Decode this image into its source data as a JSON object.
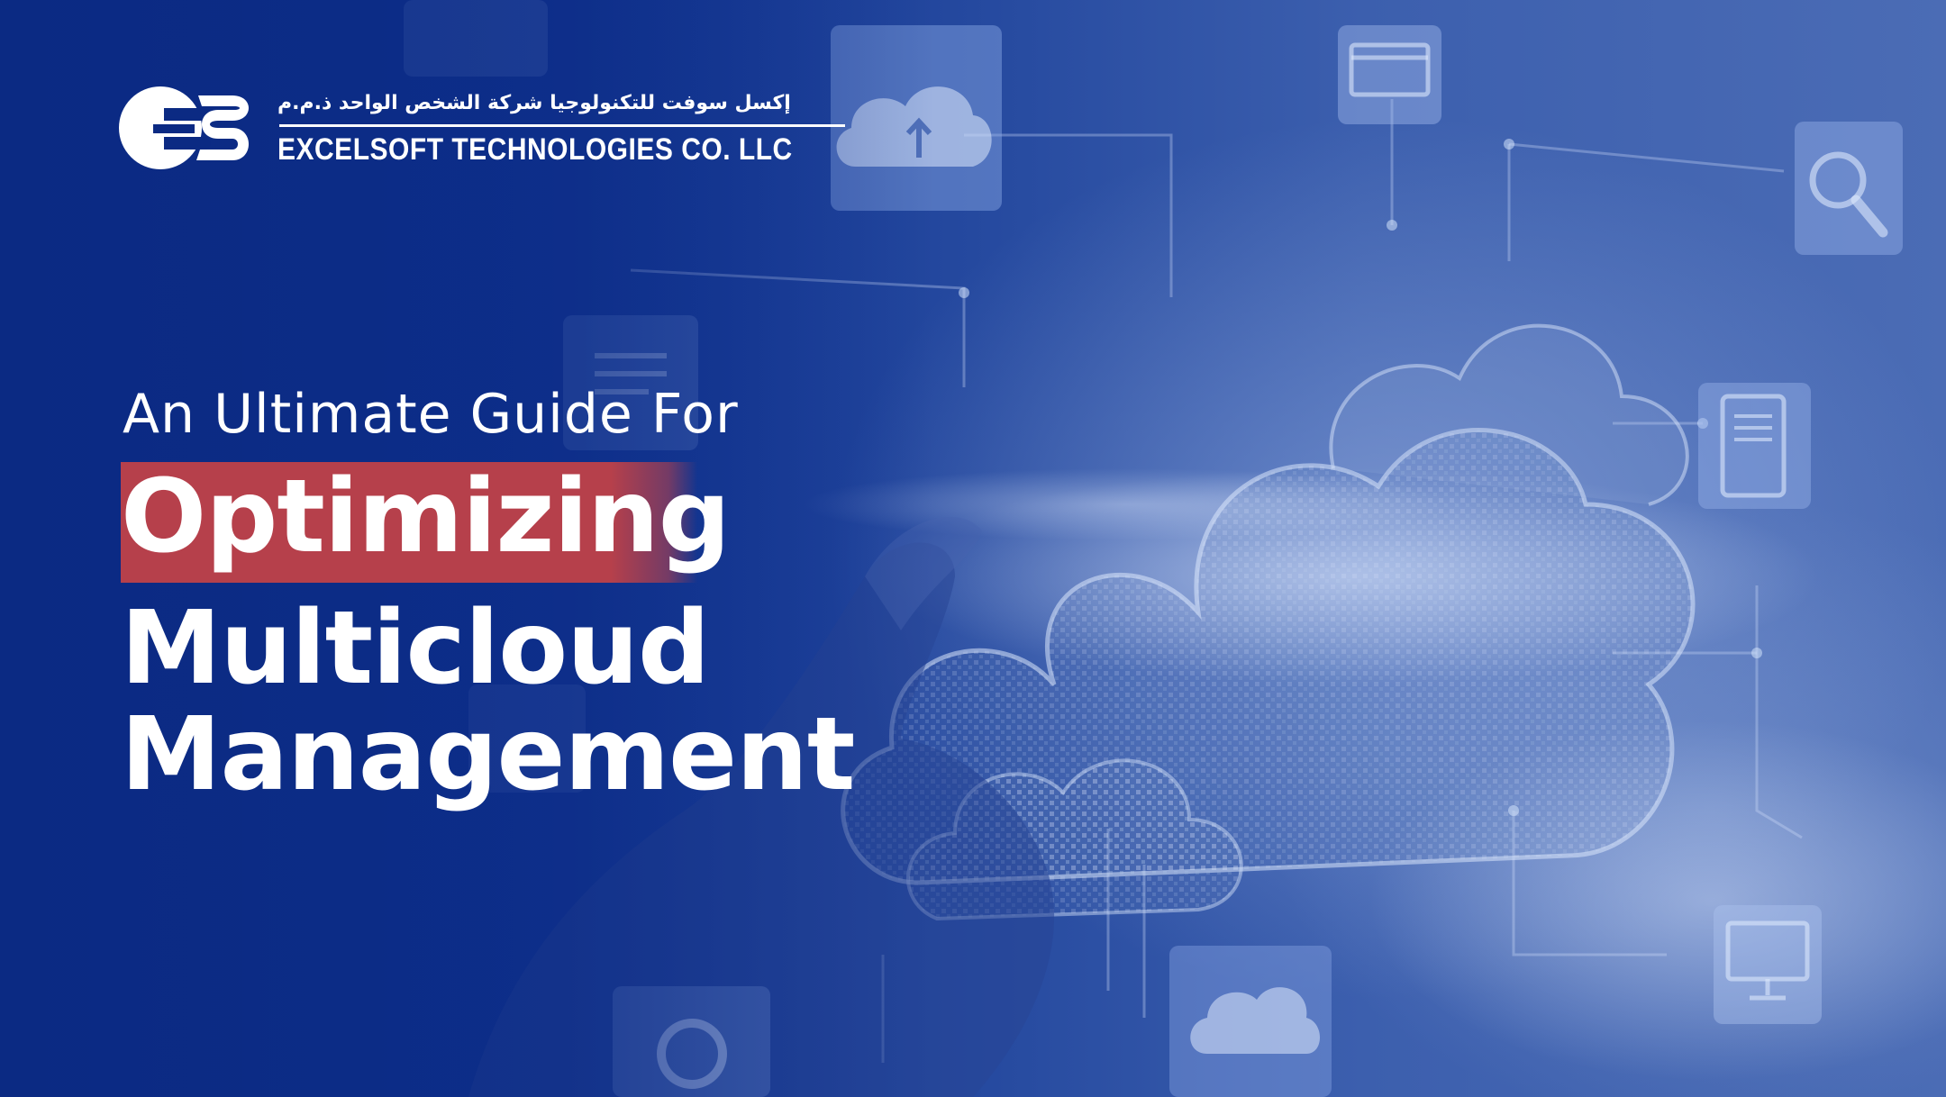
{
  "brand": {
    "arabic_name": "إكسل سوفت للتكنولوجيا شركة الشخص الواحد ذ.م.م",
    "english_name": "EXCELSOFT TECHNOLOGIES CO. LLC",
    "logo_letters": "ES"
  },
  "headline": {
    "subtitle": "An Ultimate Guide For",
    "highlighted_word": "Optimizing",
    "line2": "Multicloud",
    "line3": "Management"
  },
  "colors": {
    "background": "#0d2d84",
    "highlight": "#b6404b",
    "text": "#ffffff"
  },
  "icons": [
    "cloud-upload-icon",
    "browser-window-icon",
    "magnifier-icon",
    "document-icon",
    "tablet-icon",
    "monitor-icon",
    "cloud-icon",
    "location-pin-icon"
  ]
}
